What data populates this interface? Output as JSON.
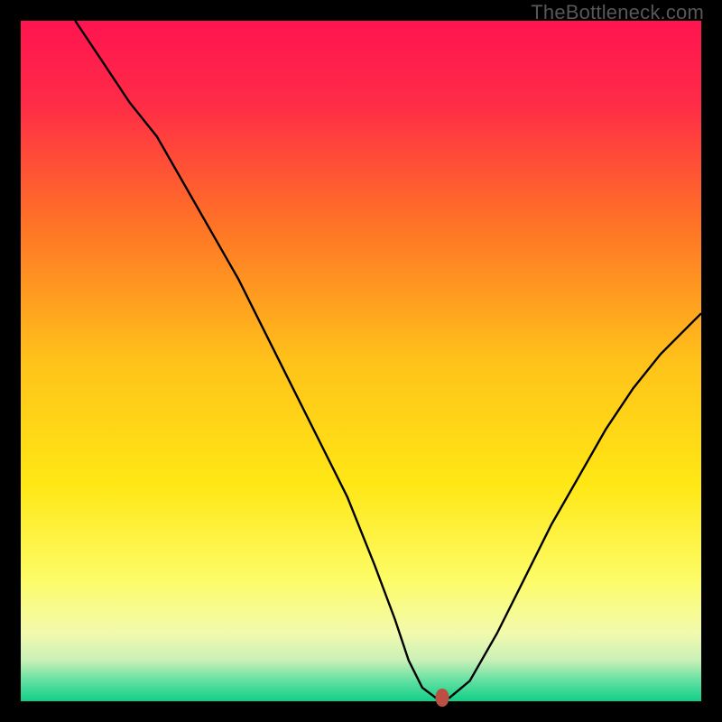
{
  "watermark": "TheBottleneck.com",
  "colors": {
    "frame": "#000000",
    "curve": "#000000",
    "marker": "#bb4f44",
    "gradient_stops": [
      {
        "pct": 0,
        "color": "#ff1450"
      },
      {
        "pct": 12,
        "color": "#ff2b47"
      },
      {
        "pct": 30,
        "color": "#ff7326"
      },
      {
        "pct": 50,
        "color": "#ffc21a"
      },
      {
        "pct": 68,
        "color": "#ffe715"
      },
      {
        "pct": 82,
        "color": "#fdfc66"
      },
      {
        "pct": 90,
        "color": "#f2faad"
      },
      {
        "pct": 94,
        "color": "#c9f0b7"
      },
      {
        "pct": 97,
        "color": "#62e0a2"
      },
      {
        "pct": 100,
        "color": "#10cf86"
      }
    ]
  },
  "chart_data": {
    "type": "line",
    "title": "",
    "xlabel": "",
    "ylabel": "",
    "xlim": [
      0,
      100
    ],
    "ylim": [
      0,
      100
    ],
    "grid": false,
    "legend": false,
    "series": [
      {
        "name": "bottleneck-curve",
        "x": [
          8,
          12,
          16,
          20,
          24,
          28,
          32,
          36,
          40,
          44,
          48,
          52,
          55,
          57,
          59,
          61,
          63,
          66,
          70,
          74,
          78,
          82,
          86,
          90,
          94,
          98,
          100
        ],
        "y": [
          100,
          94,
          88,
          83,
          76,
          69,
          62,
          54,
          46,
          38,
          30,
          20,
          12,
          6,
          2,
          0.5,
          0.5,
          3,
          10,
          18,
          26,
          33,
          40,
          46,
          51,
          55,
          57
        ]
      }
    ],
    "annotations": [
      {
        "name": "optimal-marker",
        "x": 62,
        "y": 0.5
      }
    ]
  }
}
